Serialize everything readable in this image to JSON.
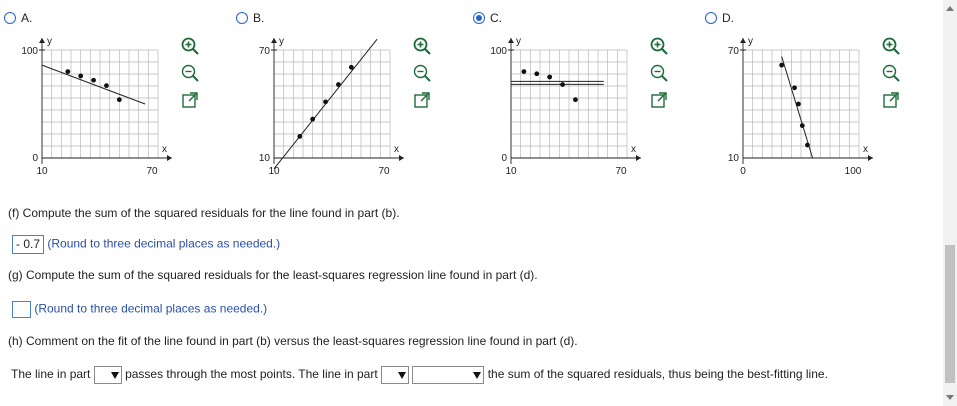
{
  "options": [
    {
      "label": "A.",
      "selected": false,
      "y_axis": "y",
      "x_axis": "x",
      "y_ticks": [
        "100",
        "0"
      ],
      "x_ticks": [
        "10",
        "70"
      ],
      "points": [
        [
          2,
          8
        ],
        [
          3,
          7.6
        ],
        [
          4,
          7.2
        ],
        [
          5,
          6.7
        ],
        [
          6,
          5.4
        ]
      ],
      "line": [
        [
          0,
          8.6
        ],
        [
          8,
          5
        ]
      ]
    },
    {
      "label": "B.",
      "selected": false,
      "y_axis": "y",
      "x_axis": "x",
      "y_ticks": [
        "70",
        "10"
      ],
      "x_ticks": [
        "10",
        "70"
      ],
      "points": [
        [
          2,
          2
        ],
        [
          3,
          3.6
        ],
        [
          4,
          5.2
        ],
        [
          5,
          6.8
        ],
        [
          6,
          8.4
        ]
      ],
      "line": [
        [
          0,
          -1
        ],
        [
          8,
          11
        ]
      ]
    },
    {
      "label": "C.",
      "selected": true,
      "y_axis": "y",
      "x_axis": "x",
      "y_ticks": [
        "100",
        "0"
      ],
      "x_ticks": [
        "10",
        "70"
      ],
      "points": [
        [
          1,
          8
        ],
        [
          2,
          7.8
        ],
        [
          3,
          7.5
        ],
        [
          4,
          6.8
        ],
        [
          5,
          5.4
        ]
      ],
      "line": [
        [
          0,
          7.1
        ],
        [
          7.2,
          7.1
        ]
      ]
    },
    {
      "label": "D.",
      "selected": false,
      "y_axis": "y",
      "x_axis": "x",
      "y_ticks": [
        "70",
        "10"
      ],
      "x_ticks": [
        "0",
        "100"
      ],
      "points": [
        [
          3,
          8.6
        ],
        [
          4,
          6.5
        ],
        [
          4.3,
          5
        ],
        [
          4.6,
          3
        ],
        [
          5,
          1.2
        ]
      ],
      "line": [
        [
          3,
          9.4
        ],
        [
          5.4,
          0
        ]
      ]
    }
  ],
  "tools": [
    "zoom-in",
    "zoom-out",
    "expand"
  ],
  "part_f": {
    "question": "(f) Compute the sum of the squared residuals for the line found in part (b).",
    "answer": "- 0.7",
    "hint": "(Round to three decimal places as needed.)"
  },
  "part_g": {
    "question": "(g) Compute the sum of the squared residuals for the least-squares regression line found in part (d).",
    "answer": "",
    "hint": "(Round to three decimal places as needed.)"
  },
  "part_h": {
    "question": "(h) Comment on the fit of the line found in part (b) versus the least-squares regression line found in part (d).",
    "sentence_1": "The line in part",
    "sentence_2": "passes through the most points. The line in part",
    "sentence_3": "the sum of the squared residuals, thus being the best-fitting line.",
    "dropdown_1": "",
    "dropdown_2": "",
    "dropdown_3": ""
  },
  "colors": {
    "accent": "#2563c9",
    "hint": "#2a4fa8"
  }
}
